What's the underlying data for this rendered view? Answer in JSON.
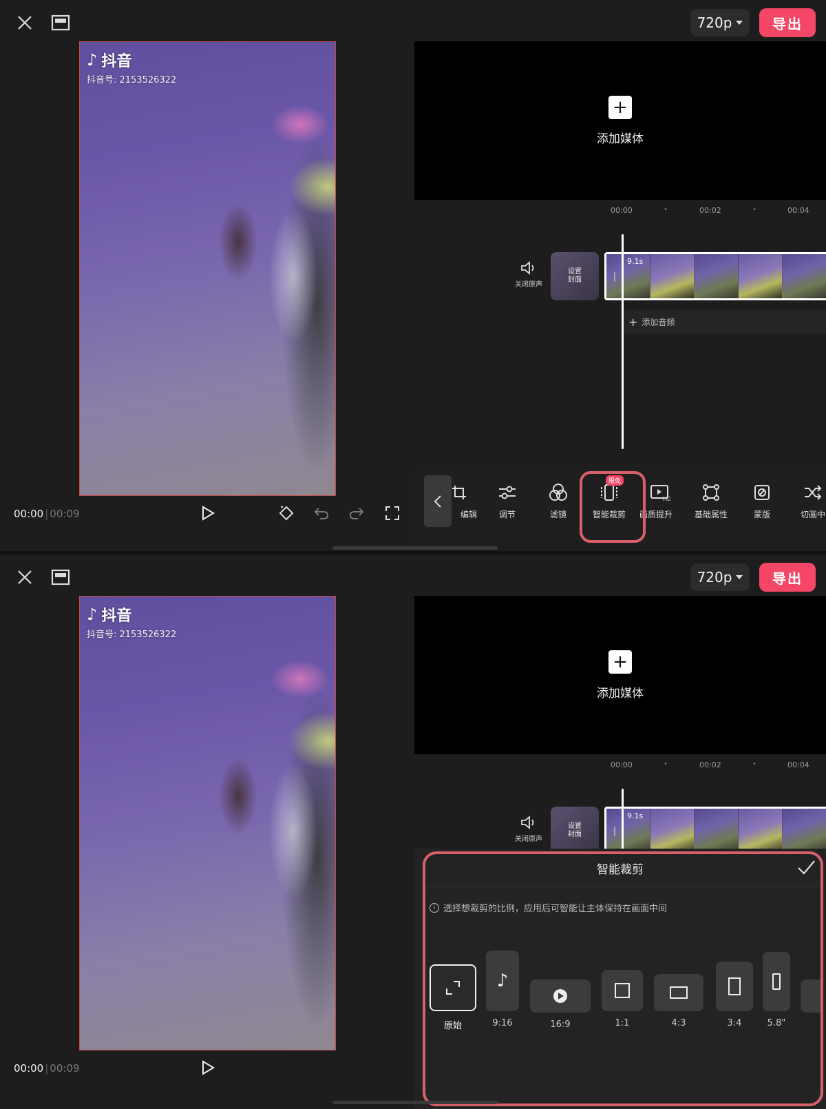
{
  "topbar": {
    "resolution": "720p",
    "export_label": "导出"
  },
  "preview": {
    "watermark_brand": "抖音",
    "watermark_id": "抖音号: 2153526322",
    "time_current": "00:00",
    "time_total": "00:09"
  },
  "media": {
    "add_media_label": "添加媒体"
  },
  "timeline": {
    "ruler": [
      "00:00",
      "00:02",
      "00:04"
    ],
    "mute_label": "关闭原声",
    "cover_label_line1": "设置",
    "cover_label_line2": "封面",
    "clip_duration": "9.1s",
    "add_audio_label": "添加音频"
  },
  "toolbar": {
    "items": [
      {
        "label": "编辑",
        "icon": "crop-edit-icon"
      },
      {
        "label": "调节",
        "icon": "sliders-icon"
      },
      {
        "label": "滤镜",
        "icon": "filter-icon"
      },
      {
        "label": "智能裁剪",
        "icon": "smart-crop-icon",
        "badge": "限免",
        "highlighted": true
      },
      {
        "label": "画质提升",
        "icon": "hd-icon"
      },
      {
        "label": "基础属性",
        "icon": "transform-icon"
      },
      {
        "label": "蒙版",
        "icon": "mask-icon"
      },
      {
        "label": "切画中",
        "icon": "shuffle-icon"
      }
    ]
  },
  "smart_crop": {
    "title": "智能裁剪",
    "hint": "选择想裁剪的比例，应用后可智能让主体保持在画面中间",
    "ratios": [
      {
        "label": "原始",
        "icon": "original-ratio-icon",
        "selected": true
      },
      {
        "label": "9:16",
        "icon": "tiktok-icon"
      },
      {
        "label": "16:9",
        "icon": "video-platform-icon"
      },
      {
        "label": "1:1",
        "icon": "square-icon"
      },
      {
        "label": "4:3",
        "icon": "landscape-icon"
      },
      {
        "label": "3:4",
        "icon": "portrait-icon"
      },
      {
        "label": "5.8\"",
        "icon": "phone-icon"
      }
    ]
  },
  "colors": {
    "accent": "#f44765",
    "highlight": "#d9606a",
    "background": "#1d1d1d"
  }
}
